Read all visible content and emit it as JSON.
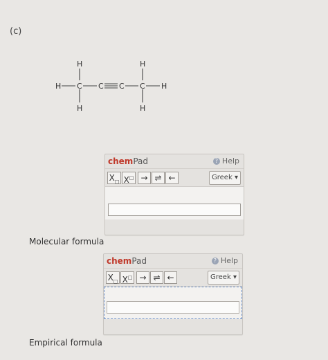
{
  "question": {
    "part_label": "(c)",
    "structure": {
      "atoms": [
        "H",
        "C",
        "C",
        "C",
        "C",
        "H",
        "H",
        "H",
        "H",
        "H",
        "H"
      ]
    }
  },
  "chempad_1": {
    "brand_bold": "chem",
    "brand_light": "Pad",
    "help_label": "Help",
    "greek_label": "Greek",
    "subscript_label": "X",
    "superscript_label": "X",
    "arrow_right_label": "→",
    "equilibrium_label": "⇌",
    "arrow_left_label": "←",
    "input_value": ""
  },
  "chempad_2": {
    "brand_bold": "chem",
    "brand_light": "Pad",
    "help_label": "Help",
    "greek_label": "Greek",
    "subscript_label": "X",
    "superscript_label": "X",
    "arrow_right_label": "→",
    "equilibrium_label": "⇌",
    "arrow_left_label": "←",
    "input_value": ""
  },
  "labels": {
    "molecular_formula": "Molecular formula",
    "empirical_formula": "Empirical formula"
  }
}
